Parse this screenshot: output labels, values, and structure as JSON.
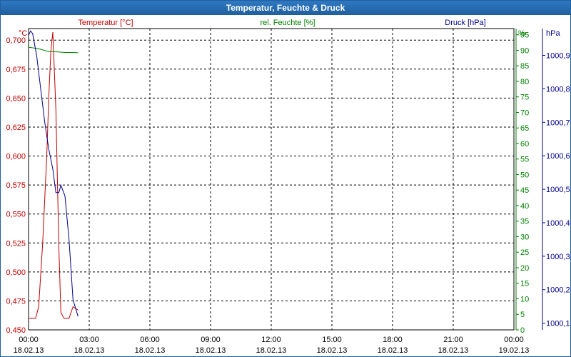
{
  "window": {
    "title": "Temperatur, Feuchte & Druck"
  },
  "colors": {
    "temperature": "#c00000",
    "humidity": "#008000",
    "pressure": "#00008b",
    "grid": "#000000",
    "titlebar": "#1f5f9e"
  },
  "chart_data": {
    "type": "line",
    "title": "Temperatur, Feuchte & Druck",
    "grid": true,
    "x": {
      "range": [
        "18.02.13 00:00",
        "19.02.13 00:00"
      ],
      "ticks": [
        {
          "time": "00:00",
          "date": "18.02.13"
        },
        {
          "time": "03:00",
          "date": "18.02.13"
        },
        {
          "time": "06:00",
          "date": "18.02.13"
        },
        {
          "time": "09:00",
          "date": "18.02.13"
        },
        {
          "time": "12:00",
          "date": "18.02.13"
        },
        {
          "time": "15:00",
          "date": "18.02.13"
        },
        {
          "time": "18:00",
          "date": "18.02.13"
        },
        {
          "time": "21:00",
          "date": "18.02.13"
        },
        {
          "time": "00:00",
          "date": "19.02.13"
        }
      ]
    },
    "axes": {
      "temperature": {
        "label": "Temperatur [°C]",
        "unit": "°C",
        "side": "left",
        "ylim": [
          0.45,
          0.71
        ],
        "ticks": [
          "0,450",
          "0,475",
          "0,500",
          "0,525",
          "0,550",
          "0,575",
          "0,600",
          "0,625",
          "0,650",
          "0,675",
          "0,700"
        ]
      },
      "humidity": {
        "label": "rel. Feuchte [%]",
        "unit": "%",
        "side": "right",
        "ylim": [
          0,
          97
        ],
        "ticks": [
          "0",
          "5",
          "10",
          "15",
          "20",
          "25",
          "30",
          "35",
          "40",
          "45",
          "50",
          "55",
          "60",
          "65",
          "70",
          "75",
          "80",
          "85",
          "90",
          "95"
        ]
      },
      "pressure": {
        "label": "Druck [hPa]",
        "unit": "hPa",
        "side": "right",
        "ylim": [
          1000.08,
          1000.98
        ],
        "ticks": [
          "1000,1",
          "1000,2",
          "1000,3",
          "1000,4",
          "1000,5",
          "1000,6",
          "1000,7",
          "1000,8",
          "1000,9"
        ]
      }
    },
    "series": [
      {
        "name": "Temperatur [°C]",
        "axis": "temperature",
        "points": [
          [
            0,
            0.46
          ],
          [
            0.35,
            0.46
          ],
          [
            0.5,
            0.47
          ],
          [
            0.7,
            0.525
          ],
          [
            0.9,
            0.6
          ],
          [
            1.0,
            0.65
          ],
          [
            1.1,
            0.69
          ],
          [
            1.2,
            0.707
          ],
          [
            1.35,
            0.64
          ],
          [
            1.5,
            0.52
          ],
          [
            1.6,
            0.465
          ],
          [
            1.75,
            0.46
          ],
          [
            2.0,
            0.46
          ],
          [
            2.2,
            0.47
          ],
          [
            2.45,
            0.467
          ]
        ]
      },
      {
        "name": "rel. Feuchte [%]",
        "axis": "humidity",
        "points": [
          [
            0,
            91
          ],
          [
            0.5,
            90.5
          ],
          [
            1.0,
            89.6
          ],
          [
            1.4,
            89.5
          ],
          [
            1.8,
            89.3
          ],
          [
            2.2,
            89.3
          ],
          [
            2.45,
            89.2
          ]
        ]
      },
      {
        "name": "Druck [hPa]",
        "axis": "pressure",
        "points": [
          [
            0,
            0.96
          ],
          [
            0.1,
            0.973
          ],
          [
            0.2,
            0.965
          ],
          [
            0.4,
            0.9
          ],
          [
            0.6,
            0.8
          ],
          [
            0.8,
            0.7
          ],
          [
            1.0,
            0.62
          ],
          [
            1.2,
            0.56
          ],
          [
            1.35,
            0.49
          ],
          [
            1.5,
            0.49
          ],
          [
            1.6,
            0.512
          ],
          [
            1.8,
            0.48
          ],
          [
            2.0,
            0.35
          ],
          [
            2.2,
            0.17
          ],
          [
            2.45,
            0.12
          ]
        ]
      }
    ]
  }
}
